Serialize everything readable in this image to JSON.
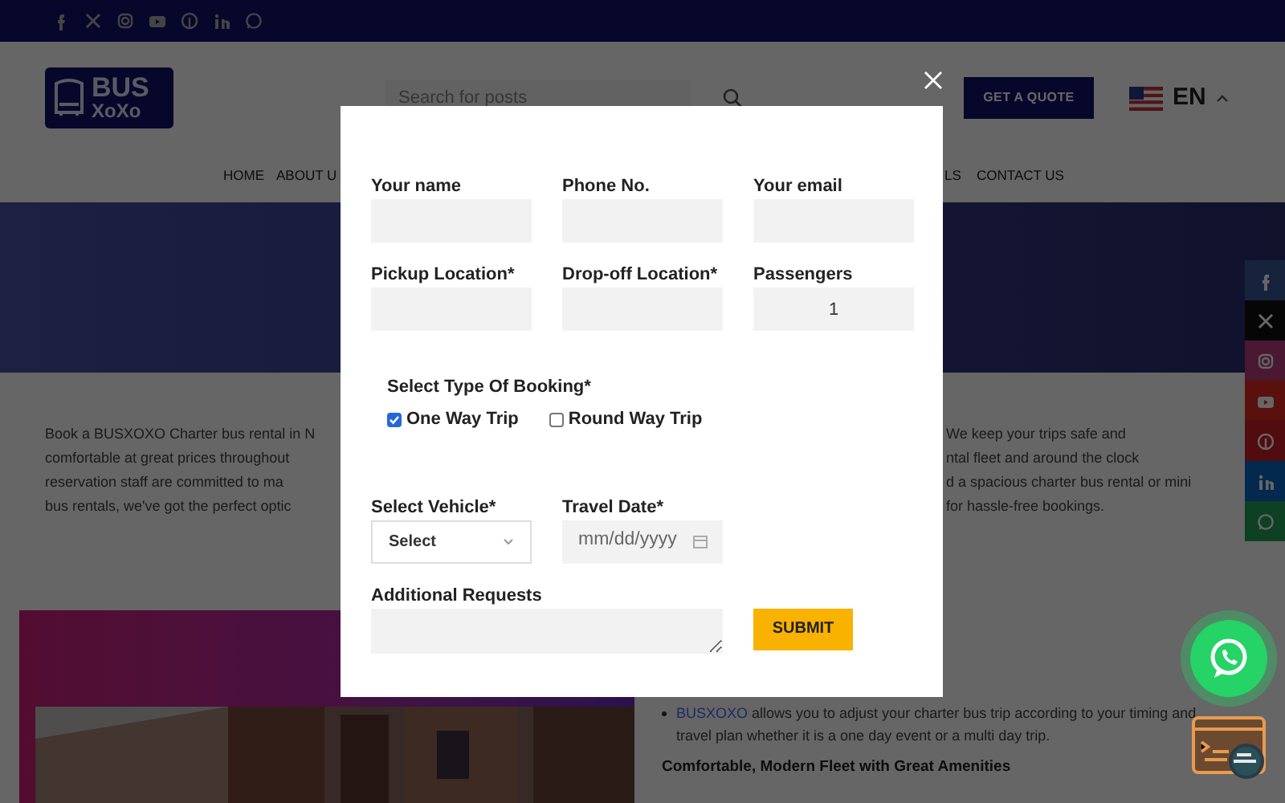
{
  "header": {
    "logo": [
      "BUS",
      "XoXo"
    ],
    "search": {
      "placeholder": "Search for posts"
    },
    "quote_button": "GET A QUOTE",
    "language": "EN"
  },
  "nav": [
    "HOME",
    "ABOUT U",
    "LS",
    "CONTACT US"
  ],
  "intro": {
    "left_lines": [
      "Book a BUSXOXO Charter bus rental in N",
      "comfortable at great prices throughout",
      "reservation staff are committed to ma",
      "bus rentals, we've got the perfect optic"
    ],
    "right_lines": [
      "We keep your trips safe and",
      "ntal fleet and around the clock",
      "d a spacious charter bus rental or mini",
      "for hassle-free bookings."
    ]
  },
  "features": {
    "bullet": {
      "link": "BUSXOXO",
      "text": " allows you to adjust your charter bus trip according to your timing and travel plan whether it is a one day event or a multi day trip."
    },
    "heading": "Comfortable, Modern Fleet with Great Amenities"
  },
  "modal": {
    "rows": [
      [
        {
          "kind": "text",
          "label": "Your name"
        },
        {
          "kind": "text",
          "label": "Phone No."
        },
        {
          "kind": "text",
          "label": "Your email"
        }
      ],
      [
        {
          "kind": "text",
          "label": "Pickup Location*"
        },
        {
          "kind": "text",
          "label": "Drop-off Location*"
        },
        {
          "kind": "number",
          "label": "Passengers",
          "value": "1"
        }
      ]
    ],
    "booking": {
      "label": "Select Type Of Booking*",
      "options": [
        {
          "label": "One Way Trip",
          "checked": true
        },
        {
          "label": "Round Way Trip",
          "checked": false
        }
      ]
    },
    "vehicle": {
      "label": "Select Vehicle*",
      "value": "Select"
    },
    "date": {
      "label": "Travel Date*",
      "placeholder": "mm/dd/yyyy"
    },
    "requests": {
      "label": "Additional Requests"
    },
    "submit": "SUBMIT"
  }
}
